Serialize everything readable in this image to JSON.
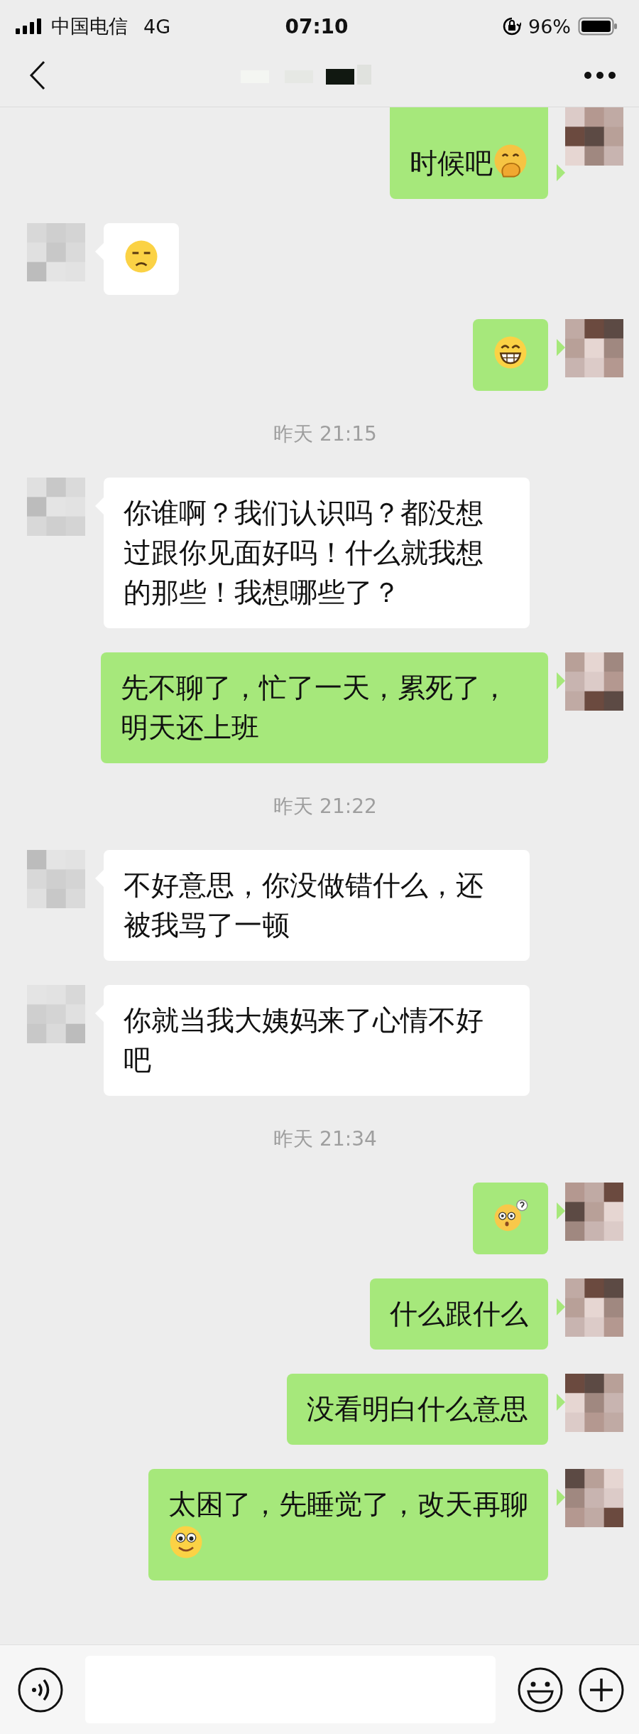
{
  "status_bar": {
    "carrier": "中国电信",
    "network": "4G",
    "time": "07:10",
    "battery": "96%"
  },
  "messages": [
    {
      "kind": "sent",
      "cut_top": true,
      "text": "时候吧",
      "emoji": {
        "kind": "shy"
      }
    },
    {
      "kind": "received",
      "cut_top": false,
      "emoji": {
        "kind": "unamused"
      }
    },
    {
      "kind": "sent",
      "cut_top": false,
      "emoji": {
        "kind": "grin"
      }
    },
    {
      "kind": "time",
      "text": "昨天 21:15"
    },
    {
      "kind": "received",
      "cut_top": false,
      "text": "你谁啊？我们认识吗？都没想过跟你见面好吗！什么就我想的那些！我想哪些了？"
    },
    {
      "kind": "sent",
      "cut_top": false,
      "text": "先不聊了，忙了一天，累死了，明天还上班"
    },
    {
      "kind": "time",
      "text": "昨天 21:22"
    },
    {
      "kind": "received",
      "cut_top": false,
      "text": "不好意思，你没做错什么，还被我骂了一顿"
    },
    {
      "kind": "received",
      "cut_top": false,
      "text": "你就当我大姨妈来了心情不好吧"
    },
    {
      "kind": "time",
      "text": "昨天 21:34"
    },
    {
      "kind": "sent",
      "cut_top": false,
      "emoji": {
        "kind": "puzzled"
      }
    },
    {
      "kind": "sent",
      "cut_top": false,
      "text": "什么跟什么"
    },
    {
      "kind": "sent",
      "cut_top": false,
      "text": "没看明白什么意思"
    },
    {
      "kind": "sent",
      "cut_top": false,
      "text": "太困了，先睡觉了，改天再聊",
      "emoji": {
        "kind": "smile"
      },
      "emoji_newline": true
    }
  ]
}
